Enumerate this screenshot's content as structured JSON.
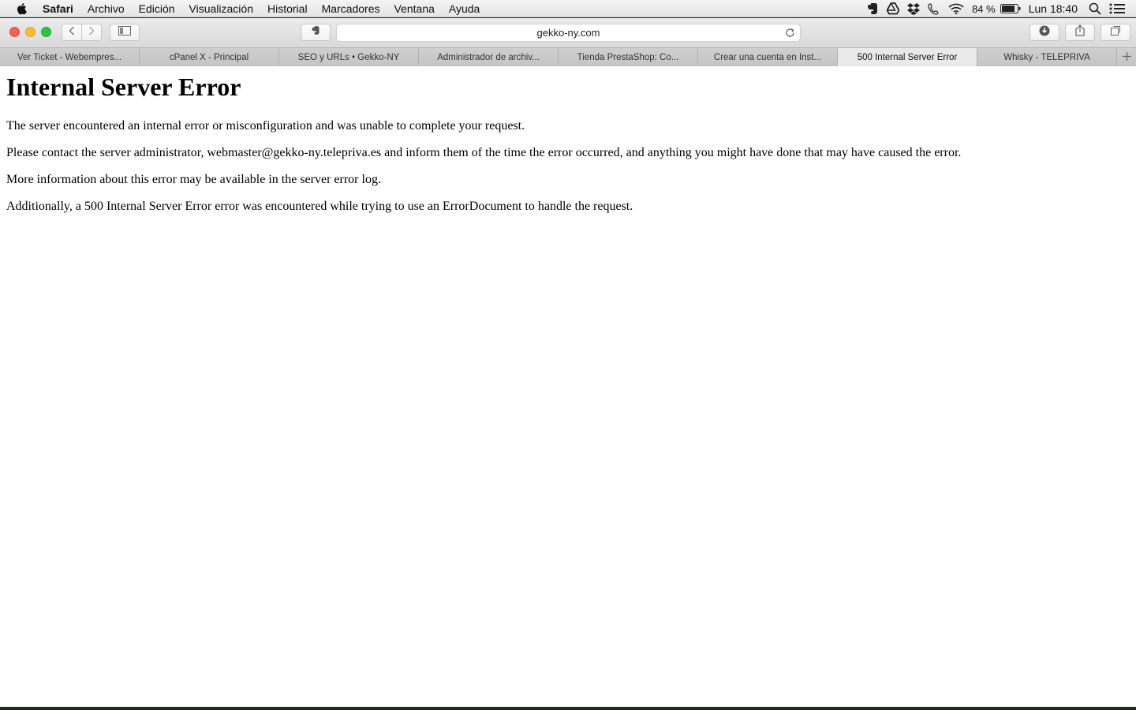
{
  "menubar": {
    "app_name": "Safari",
    "items": [
      "Archivo",
      "Edición",
      "Visualización",
      "Historial",
      "Marcadores",
      "Ventana",
      "Ayuda"
    ],
    "battery_percent": "84 %",
    "clock": "Lun 18:40",
    "tray_icons": [
      "evernote-icon",
      "google-drive-icon",
      "dropbox-icon",
      "phone-icon",
      "wifi-icon",
      "battery-icon",
      "spotlight-icon",
      "notification-center-icon"
    ]
  },
  "toolbar": {
    "url": "gekko-ny.com"
  },
  "tabs": [
    {
      "label": "Ver Ticket - Webempres...",
      "active": false
    },
    {
      "label": "cPanel X - Principal",
      "active": false
    },
    {
      "label": "SEO y URLs • Gekko-NY",
      "active": false
    },
    {
      "label": "Administrador de archiv...",
      "active": false
    },
    {
      "label": "Tienda PrestaShop: Co...",
      "active": false
    },
    {
      "label": "Crear una cuenta en Inst...",
      "active": false
    },
    {
      "label": "500 Internal Server Error",
      "active": true
    },
    {
      "label": "Whisky - TELEPRIVA",
      "active": false
    }
  ],
  "page": {
    "heading": "Internal Server Error",
    "paragraphs": [
      "The server encountered an internal error or misconfiguration and was unable to complete your request.",
      "Please contact the server administrator, webmaster@gekko-ny.telepriva.es and inform them of the time the error occurred, and anything you might have done that may have caused the error.",
      "More information about this error may be available in the server error log.",
      "Additionally, a 500 Internal Server Error error was encountered while trying to use an ErrorDocument to handle the request."
    ]
  }
}
